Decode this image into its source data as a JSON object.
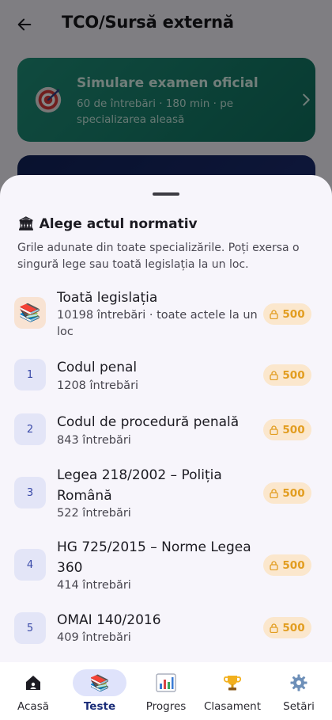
{
  "header": {
    "title": "TCO/Sursă externă"
  },
  "simulation_card": {
    "title": "Simulare examen oficial",
    "subtitle": "60 de întrebări · 180 min · pe specializarea aleasă"
  },
  "sheet": {
    "title": "Alege actul normativ",
    "description": "Grile adunate din toate specializările. Poți exersa o singură lege sau toată legislația la un loc.",
    "items": [
      {
        "badge": "📚",
        "name": "Toată legislația",
        "meta": "10198 întrebări · toate actele la un loc",
        "price": "500"
      },
      {
        "badge": "1",
        "name": "Codul penal",
        "meta": "1208 întrebări",
        "price": "500"
      },
      {
        "badge": "2",
        "name": "Codul de procedură penală",
        "meta": "843 întrebări",
        "price": "500"
      },
      {
        "badge": "3",
        "name": "Legea 218/2002 – Poliția Română",
        "meta": "522 întrebări",
        "price": "500"
      },
      {
        "badge": "4",
        "name": "HG 725/2015 – Norme Legea 360",
        "meta": "414 întrebări",
        "price": "500"
      },
      {
        "badge": "5",
        "name": "OMAI 140/2016",
        "meta": "409 întrebări",
        "price": "500"
      }
    ]
  },
  "bottom_nav": {
    "items": [
      {
        "label": "Acasă",
        "icon": "house-icon"
      },
      {
        "label": "Teste",
        "icon": "books-icon"
      },
      {
        "label": "Progres",
        "icon": "chart-icon"
      },
      {
        "label": "Clasament",
        "icon": "trophy-icon"
      },
      {
        "label": "Setări",
        "icon": "gear-icon"
      }
    ],
    "active_index": 1
  },
  "colors": {
    "accent": "#1a2c78",
    "price_text": "#e29d20",
    "price_bg": "#fbe7cd",
    "sim_card": "#1f8f79"
  }
}
